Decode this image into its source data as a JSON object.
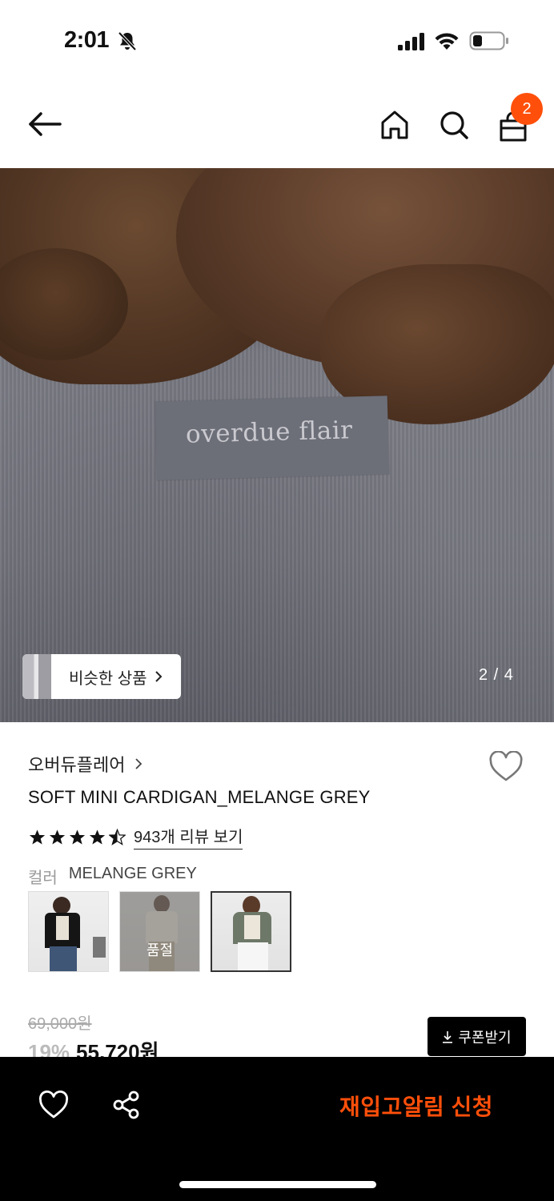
{
  "status_bar": {
    "time": "2:01",
    "icons": [
      "bell-slash-icon",
      "signal-icon",
      "wifi-icon",
      "battery-icon"
    ]
  },
  "nav": {
    "icons": [
      "back-arrow-icon",
      "home-icon",
      "search-icon",
      "shopping-bag-icon"
    ],
    "cart_count": "2"
  },
  "hero": {
    "label_text": "overdue flair",
    "similar_products_label": "비슷한 상품",
    "page_indicator": "2 / 4"
  },
  "product": {
    "brand": "오버듀플레어",
    "title": "SOFT MINI CARDIGAN_MELANGE GREY",
    "rating": 4.5,
    "review_link": "943개 리뷰 보기",
    "color_key": "컬러",
    "color_value": "MELANGE GREY",
    "swatches": [
      {
        "selected": false,
        "soldout": false
      },
      {
        "selected": false,
        "soldout": true,
        "soldout_label": "품절"
      },
      {
        "selected": true,
        "soldout": false
      }
    ],
    "original_price": "69,000원",
    "discount": "19%",
    "sale_price": "55,720원",
    "coupon_label": "쿠폰받기"
  },
  "bottom_bar": {
    "restock_label": "재입고알림 신청"
  },
  "colors": {
    "accent": "#ff4f0a",
    "bottom_bar_bg": "#000000"
  }
}
